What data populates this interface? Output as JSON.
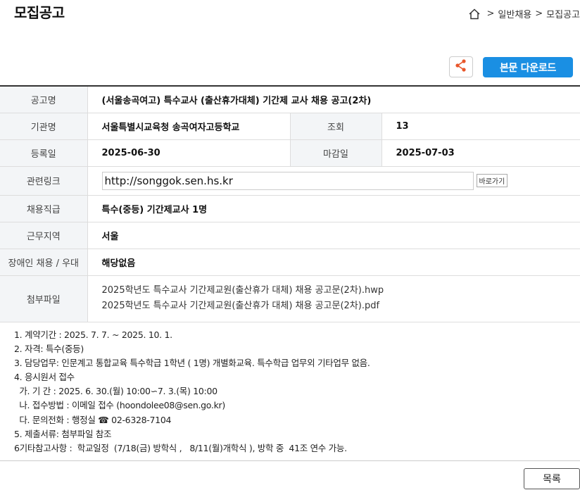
{
  "header": {
    "title": "모집공고",
    "breadcrumb": [
      "일반채용",
      "모집공고"
    ]
  },
  "toolbar": {
    "share_icon": "share-icon",
    "download_label": "본문 다운로드"
  },
  "info": {
    "title_label": "공고명",
    "title_value": "(서울송곡여고) 특수교사 (출산휴가대체) 기간제 교사 채용 공고(2차)",
    "org_label": "기관명",
    "org_value": "서울특별시교육청 송곡여자고등학교",
    "views_label": "조회",
    "views_value": "13",
    "reg_label": "등록일",
    "reg_value": "2025-06-30",
    "deadline_label": "마감일",
    "deadline_value": "2025-07-03",
    "link_label": "관련링크",
    "link_value": "http://songgok.sen.hs.kr",
    "link_go": "바로가기",
    "job_label": "채용직급",
    "job_value": "특수(중등) 기간제교사 1명",
    "region_label": "근무지역",
    "region_value": "서울",
    "disabled_label": "장애인 채용 / 우대",
    "disabled_value": "해당없음",
    "files_label": "첨부파일",
    "files": [
      "2025학년도 특수교사 기간제교원(출산휴가 대체) 채용 공고문(2차).hwp",
      "2025학년도 특수교사 기간제교원(출산휴가 대체) 채용 공고문(2차).pdf"
    ]
  },
  "body": {
    "lines": [
      "1. 계약기간 : 2025. 7. 7. ~ 2025. 10. 1.",
      "2. 자격: 특수(중등)",
      "3. 담당업무: 인문계고 통합교육 특수학급 1학년 ( 1명) 개별화교육. 특수학급 업무외 기타업무 없음.",
      "4. 응시원서 접수",
      "  가. 기 간 : 2025. 6. 30.(월) 10:00∽7. 3.(목) 10:00",
      "  나. 접수방법 : 이메일 접수 (hoondolee08@sen.go.kr)",
      "  다. 문의전화 : 행정실 ☎ 02-6328-7104",
      "5. 제출서류: 첨부파일 참조",
      "6기타참고사항 :  학교일정  (7/18(금) 방학식 ,   8/11(월)개학식 ), 방학 중  41조 연수 가능."
    ]
  },
  "footer": {
    "list_label": "목록"
  }
}
